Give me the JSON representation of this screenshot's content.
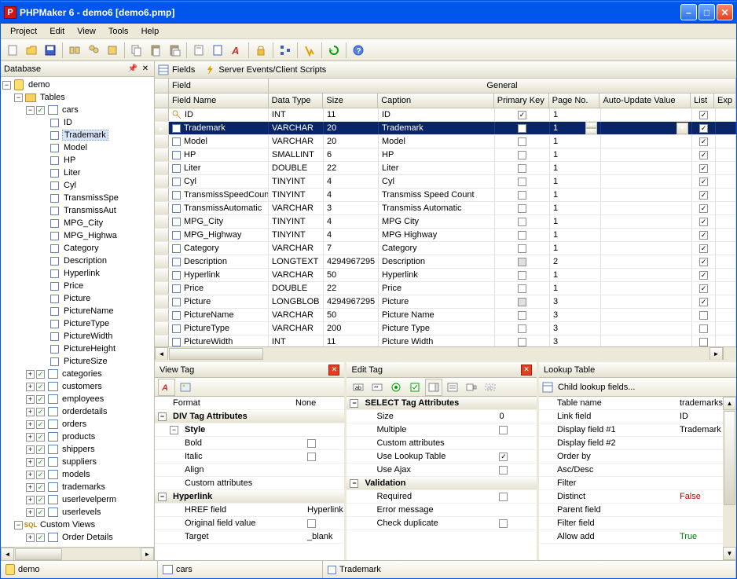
{
  "title": "PHPMaker 6 - demo6 [demo6.pmp]",
  "menu": [
    "Project",
    "Edit",
    "View",
    "Tools",
    "Help"
  ],
  "leftPane": {
    "title": "Database"
  },
  "tree": {
    "root": "demo",
    "tablesLabel": "Tables",
    "customViewsLabel": "Custom Views",
    "orderDetails": "Order Details",
    "carsLabel": "cars",
    "carsFields": [
      "ID",
      "Trademark",
      "Model",
      "HP",
      "Liter",
      "Cyl",
      "TransmissSpe",
      "TransmissAut",
      "MPG_City",
      "MPG_Highwa",
      "Category",
      "Description",
      "Hyperlink",
      "Price",
      "Picture",
      "PictureName",
      "PictureType",
      "PictureWidth",
      "PictureHeight",
      "PictureSize"
    ],
    "selectedField": "Trademark",
    "otherTables": [
      "categories",
      "customers",
      "employees",
      "orderdetails",
      "orders",
      "products",
      "shippers",
      "suppliers",
      "models",
      "trademarks",
      "userlevelperm",
      "userlevels"
    ]
  },
  "tabs": {
    "fields": "Fields",
    "scripts": "Server Events/Client Scripts"
  },
  "gridHeaders": {
    "field": "Field",
    "general": "General",
    "fieldName": "Field Name",
    "dataType": "Data Type",
    "size": "Size",
    "caption": "Caption",
    "primaryKey": "Primary Key",
    "pageNo": "Page No.",
    "autoUpdate": "Auto-Update Value",
    "list": "List",
    "exp": "Exp"
  },
  "gridRows": [
    {
      "name": "ID",
      "type": "INT",
      "size": "11",
      "caption": "ID",
      "pk": true,
      "page": "1",
      "list": true,
      "key": true
    },
    {
      "name": "Trademark",
      "type": "VARCHAR",
      "size": "20",
      "caption": "Trademark",
      "pk": false,
      "page": "1",
      "list": true,
      "selected": true
    },
    {
      "name": "Model",
      "type": "VARCHAR",
      "size": "20",
      "caption": "Model",
      "pk": false,
      "page": "1",
      "list": true
    },
    {
      "name": "HP",
      "type": "SMALLINT",
      "size": "6",
      "caption": "HP",
      "pk": false,
      "page": "1",
      "list": true
    },
    {
      "name": "Liter",
      "type": "DOUBLE",
      "size": "22",
      "caption": "Liter",
      "pk": false,
      "page": "1",
      "list": true
    },
    {
      "name": "Cyl",
      "type": "TINYINT",
      "size": "4",
      "caption": "Cyl",
      "pk": false,
      "page": "1",
      "list": true
    },
    {
      "name": "TransmissSpeedCount",
      "type": "TINYINT",
      "size": "4",
      "caption": "Transmiss Speed Count",
      "pk": false,
      "page": "1",
      "list": true
    },
    {
      "name": "TransmissAutomatic",
      "type": "VARCHAR",
      "size": "3",
      "caption": "Transmiss Automatic",
      "pk": false,
      "page": "1",
      "list": true
    },
    {
      "name": "MPG_City",
      "type": "TINYINT",
      "size": "4",
      "caption": "MPG City",
      "pk": false,
      "page": "1",
      "list": true
    },
    {
      "name": "MPG_Highway",
      "type": "TINYINT",
      "size": "4",
      "caption": "MPG Highway",
      "pk": false,
      "page": "1",
      "list": true
    },
    {
      "name": "Category",
      "type": "VARCHAR",
      "size": "7",
      "caption": "Category",
      "pk": false,
      "page": "1",
      "list": true
    },
    {
      "name": "Description",
      "type": "LONGTEXT",
      "size": "4294967295",
      "caption": "Description",
      "pk": false,
      "pkgray": true,
      "page": "2",
      "list": true
    },
    {
      "name": "Hyperlink",
      "type": "VARCHAR",
      "size": "50",
      "caption": "Hyperlink",
      "pk": false,
      "page": "1",
      "list": true
    },
    {
      "name": "Price",
      "type": "DOUBLE",
      "size": "22",
      "caption": "Price",
      "pk": false,
      "page": "1",
      "list": true
    },
    {
      "name": "Picture",
      "type": "LONGBLOB",
      "size": "4294967295",
      "caption": "Picture",
      "pk": false,
      "pkgray": true,
      "page": "3",
      "list": true
    },
    {
      "name": "PictureName",
      "type": "VARCHAR",
      "size": "50",
      "caption": "Picture Name",
      "pk": false,
      "page": "3",
      "list": false
    },
    {
      "name": "PictureType",
      "type": "VARCHAR",
      "size": "200",
      "caption": "Picture Type",
      "pk": false,
      "page": "3",
      "list": false
    },
    {
      "name": "PictureWidth",
      "type": "INT",
      "size": "11",
      "caption": "Picture Width",
      "pk": false,
      "page": "3",
      "list": false
    }
  ],
  "viewTag": {
    "title": "View Tag",
    "formatLabel": "Format",
    "formatValue": "None",
    "divSection": "DIV Tag Attributes",
    "styleSection": "Style",
    "bold": "Bold",
    "italic": "Italic",
    "align": "Align",
    "custom": "Custom attributes",
    "hyperlinkSection": "Hyperlink",
    "hrefField": "HREF field",
    "hrefValue": "Hyperlink",
    "origField": "Original field value",
    "target": "Target",
    "targetValue": "_blank"
  },
  "editTag": {
    "title": "Edit Tag",
    "selectSection": "SELECT Tag Attributes",
    "size": "Size",
    "sizeValue": "0",
    "multiple": "Multiple",
    "custom": "Custom attributes",
    "useLookup": "Use Lookup Table",
    "useAjax": "Use Ajax",
    "validationSection": "Validation",
    "required": "Required",
    "errorMsg": "Error message",
    "checkDup": "Check duplicate"
  },
  "lookupTable": {
    "title": "Lookup Table",
    "childLookup": "Child lookup fields...",
    "tableName": "Table name",
    "tableNameValue": "trademarks",
    "linkField": "Link field",
    "linkFieldValue": "ID",
    "display1": "Display field #1",
    "display1Value": "Trademark",
    "display2": "Display field #2",
    "orderBy": "Order by",
    "ascDesc": "Asc/Desc",
    "filter": "Filter",
    "distinct": "Distinct",
    "distinctValue": "False",
    "parentField": "Parent field",
    "filterField": "Filter field",
    "allowAdd": "Allow add",
    "allowAddValue": "True"
  },
  "statusbar": {
    "db": "demo",
    "table": "cars",
    "field": "Trademark"
  }
}
